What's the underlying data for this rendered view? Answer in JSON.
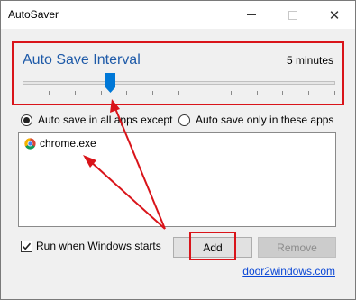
{
  "window": {
    "title": "AutoSaver",
    "controls": [
      "minimize",
      "maximize",
      "close"
    ]
  },
  "interval": {
    "title": "Auto Save Interval",
    "value_label": "5 minutes",
    "slider_level": 0.28
  },
  "mode": {
    "options": [
      {
        "label": "Auto save in all apps except",
        "selected": true
      },
      {
        "label": "Auto save only in these apps",
        "selected": false
      }
    ]
  },
  "app_list": {
    "items": [
      {
        "name": "chrome.exe",
        "icon": "chrome-icon"
      }
    ]
  },
  "startup": {
    "label": "Run when Windows starts",
    "checked": true
  },
  "buttons": {
    "add_label": "Add",
    "remove_label": "Remove"
  },
  "footer": {
    "link_text": "door2windows.com"
  },
  "colors": {
    "highlight": "#d9141a",
    "title_blue": "#1e5aa8",
    "link": "#0a47d6"
  }
}
